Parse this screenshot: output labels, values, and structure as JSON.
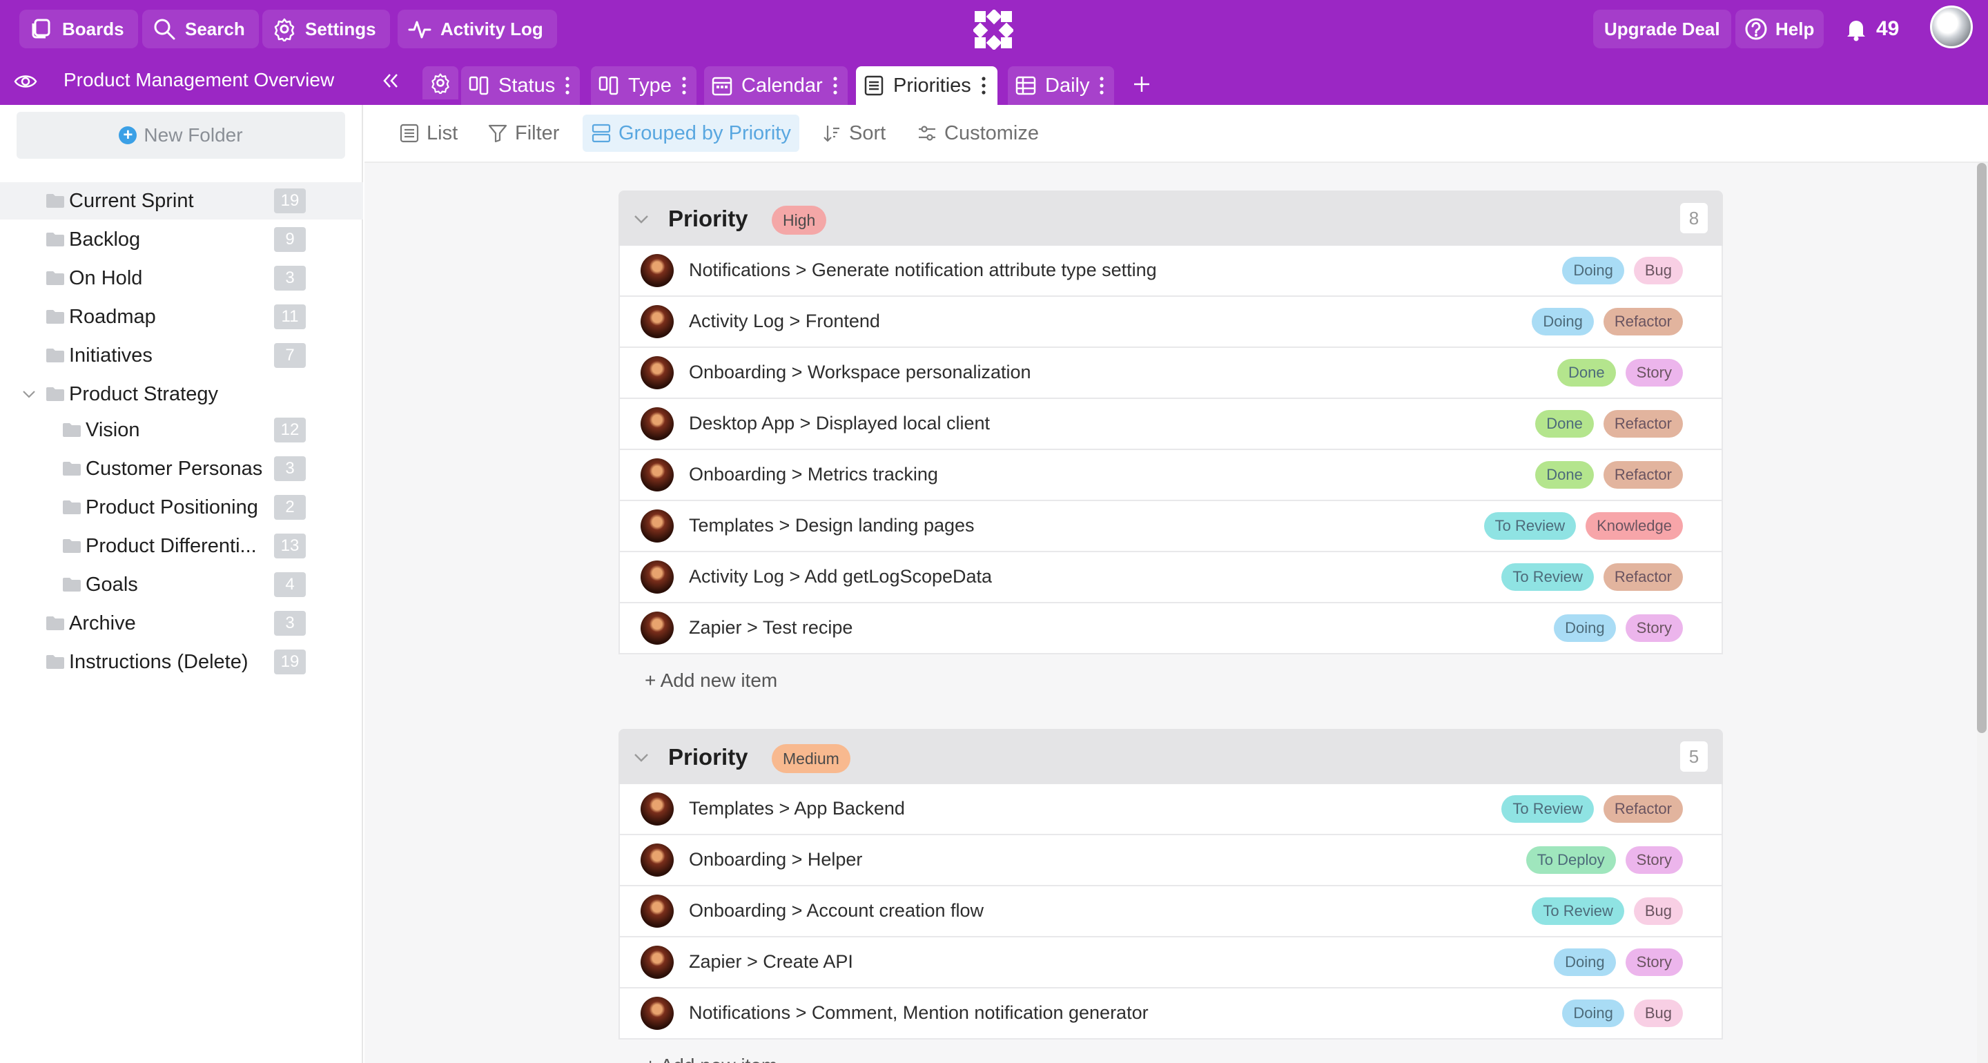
{
  "topbar": {
    "boards_label": "Boards",
    "search_label": "Search",
    "settings_label": "Settings",
    "activity_label": "Activity Log",
    "upgrade_label": "Upgrade Deal",
    "help_label": "Help",
    "notifications_count": "49",
    "accent_color": "#9b27c4"
  },
  "tabbar": {
    "board_title": "Product Management Overview",
    "tabs": [
      {
        "label": "Status",
        "icon": "columns-icon"
      },
      {
        "label": "Type",
        "icon": "columns-icon"
      },
      {
        "label": "Calendar",
        "icon": "calendar-icon"
      },
      {
        "label": "Priorities",
        "icon": "list-icon",
        "active": true
      },
      {
        "label": "Daily",
        "icon": "table-icon"
      }
    ]
  },
  "sidebar": {
    "new_folder_label": "New Folder",
    "folders": [
      {
        "name": "Current Sprint",
        "count": "19"
      },
      {
        "name": "Backlog",
        "count": "9"
      },
      {
        "name": "On Hold",
        "count": "3"
      },
      {
        "name": "Roadmap",
        "count": "11"
      },
      {
        "name": "Initiatives",
        "count": "7"
      },
      {
        "name": "Product Strategy",
        "expanded": true
      },
      {
        "name": "Vision",
        "count": "12"
      },
      {
        "name": "Customer Personas",
        "count": "3"
      },
      {
        "name": "Product Positioning",
        "count": "2"
      },
      {
        "name": "Product Differenti...",
        "count": "13"
      },
      {
        "name": "Goals",
        "count": "4"
      },
      {
        "name": "Archive",
        "count": "3"
      },
      {
        "name": "Instructions (Delete)",
        "count": "19"
      }
    ]
  },
  "toolbar": {
    "list_label": "List",
    "filter_label": "Filter",
    "grouped_label": "Grouped by Priority",
    "sort_label": "Sort",
    "customize_label": "Customize"
  },
  "groups": [
    {
      "title": "Priority",
      "badge": "High",
      "badge_color": "#f4a7a7",
      "count": "8",
      "add_label": "+ Add new item",
      "items": [
        {
          "title": "Notifications > Generate notification attribute type setting",
          "status": "Doing",
          "type": "Bug"
        },
        {
          "title": "Activity Log > Frontend",
          "status": "Doing",
          "type": "Refactor"
        },
        {
          "title": "Onboarding > Workspace personalization",
          "status": "Done",
          "type": "Story"
        },
        {
          "title": "Desktop App > Displayed local client",
          "status": "Done",
          "type": "Refactor"
        },
        {
          "title": "Onboarding > Metrics tracking",
          "status": "Done",
          "type": "Refactor"
        },
        {
          "title": "Templates > Design landing pages",
          "status": "To Review",
          "type": "Knowledge"
        },
        {
          "title": "Activity Log > Add getLogScopeData",
          "status": "To Review",
          "type": "Refactor"
        },
        {
          "title": "Zapier > Test recipe",
          "status": "Doing",
          "type": "Story"
        }
      ]
    },
    {
      "title": "Priority",
      "badge": "Medium",
      "badge_color": "#f8b98f",
      "count": "5",
      "add_label": "+ Add new item",
      "items": [
        {
          "title": "Templates > App Backend",
          "status": "To Review",
          "type": "Refactor"
        },
        {
          "title": "Onboarding > Helper",
          "status": "To Deploy",
          "type": "Story"
        },
        {
          "title": "Onboarding > Account creation flow",
          "status": "To Review",
          "type": "Bug"
        },
        {
          "title": "Zapier > Create API",
          "status": "Doing",
          "type": "Story"
        },
        {
          "title": "Notifications > Comment, Mention notification generator",
          "status": "Doing",
          "type": "Bug"
        }
      ]
    }
  ],
  "tag_colors": {
    "Doing": "#a9dcf5",
    "Done": "#b4e58d",
    "To Review": "#8fe3e3",
    "To Deploy": "#9fe6bd",
    "Bug": "#f8cfe4",
    "Refactor": "#e2b49e",
    "Story": "#ecb5ec",
    "Knowledge": "#f7a5a9"
  }
}
